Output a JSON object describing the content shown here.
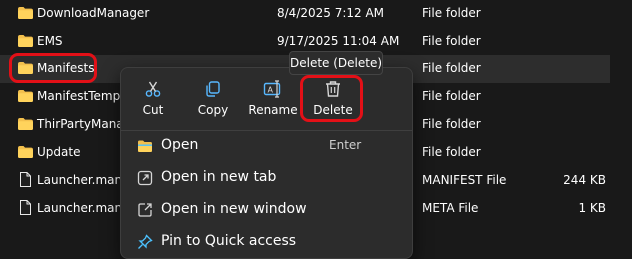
{
  "files": [
    {
      "name": "DownloadManager",
      "date": "8/4/2025 7:12 AM",
      "type": "File folder",
      "size": "",
      "icon": "folder-icon"
    },
    {
      "name": "EMS",
      "date": "9/17/2025 11:04 AM",
      "type": "File folder",
      "size": "",
      "icon": "folder-icon"
    },
    {
      "name": "Manifests",
      "date": "",
      "type": "File folder",
      "size": "",
      "icon": "folder-icon"
    },
    {
      "name": "ManifestTemp",
      "date": "",
      "type": "File folder",
      "size": "",
      "icon": "folder-icon"
    },
    {
      "name": "ThirPartyManag",
      "date": "",
      "type": "File folder",
      "size": "",
      "icon": "folder-icon"
    },
    {
      "name": "Update",
      "date": "",
      "type": "File folder",
      "size": "",
      "icon": "folder-icon"
    },
    {
      "name": "Launcher.manit",
      "date": "",
      "type": "MANIFEST File",
      "size": "244 KB",
      "icon": "file-icon"
    },
    {
      "name": "Launcher.manit",
      "date": "",
      "type": "META File",
      "size": "1 KB",
      "icon": "file-icon"
    }
  ],
  "context_menu": {
    "actions": [
      {
        "label": "Cut",
        "icon": "scissors-icon"
      },
      {
        "label": "Copy",
        "icon": "copy-icon"
      },
      {
        "label": "Rename",
        "icon": "rename-icon"
      },
      {
        "label": "Delete",
        "icon": "trash-icon"
      }
    ],
    "items": [
      {
        "label": "Open",
        "shortcut": "Enter",
        "icon": "folder-open-icon"
      },
      {
        "label": "Open in new tab",
        "shortcut": "",
        "icon": "new-tab-icon"
      },
      {
        "label": "Open in new window",
        "shortcut": "",
        "icon": "new-window-icon"
      },
      {
        "label": "Pin to Quick access",
        "shortcut": "",
        "icon": "pin-icon"
      }
    ]
  },
  "tooltip": {
    "text": "Delete (Delete)"
  },
  "colors": {
    "folder": "#f3c04d",
    "highlight": "#e31017",
    "accent": "#4cc2ff"
  }
}
